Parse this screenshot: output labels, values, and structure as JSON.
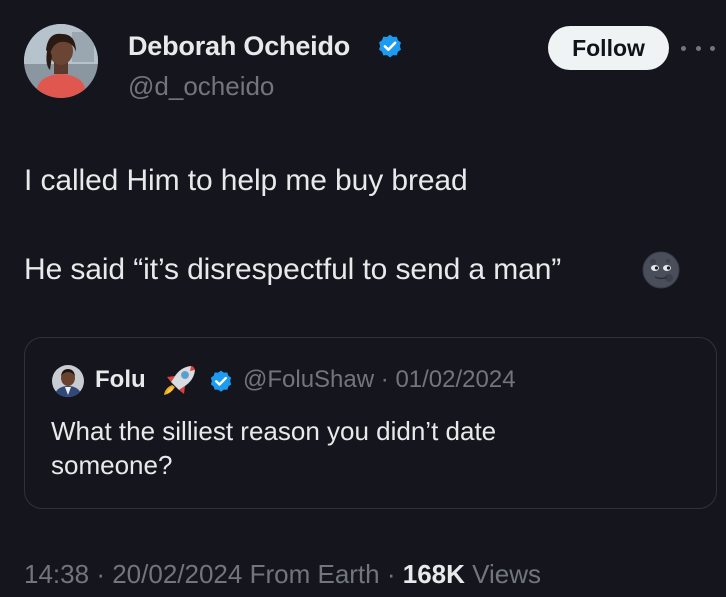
{
  "author": {
    "display_name": "Deborah Ocheido",
    "handle": "@d_ocheido",
    "verified": true
  },
  "actions": {
    "follow_label": "Follow",
    "more_icon": "more-horizontal-icon"
  },
  "tweet": {
    "line1": "I called Him to help me buy bread",
    "line2": "He said “it’s disrespectful to send a man”",
    "emoji": "new-moon-face-emoji"
  },
  "quoted_tweet": {
    "display_name": "Folu",
    "name_emoji": "rocket-icon",
    "verified": true,
    "handle": "@FoluShaw",
    "separator": "·",
    "date": "01/02/2024",
    "text": "What the silliest reason you didn’t date someone?"
  },
  "footer": {
    "time": "14:38",
    "separator": "·",
    "date": "20/02/2024",
    "source": "From Earth",
    "views_count": "168K",
    "views_label": "Views"
  },
  "colors": {
    "background": "#15161d",
    "primary_text": "#e7e9ea",
    "secondary_text": "#71767b",
    "verified_blue": "#1d9bf0",
    "border": "#2f3336",
    "follow_bg": "#eff3f4"
  }
}
